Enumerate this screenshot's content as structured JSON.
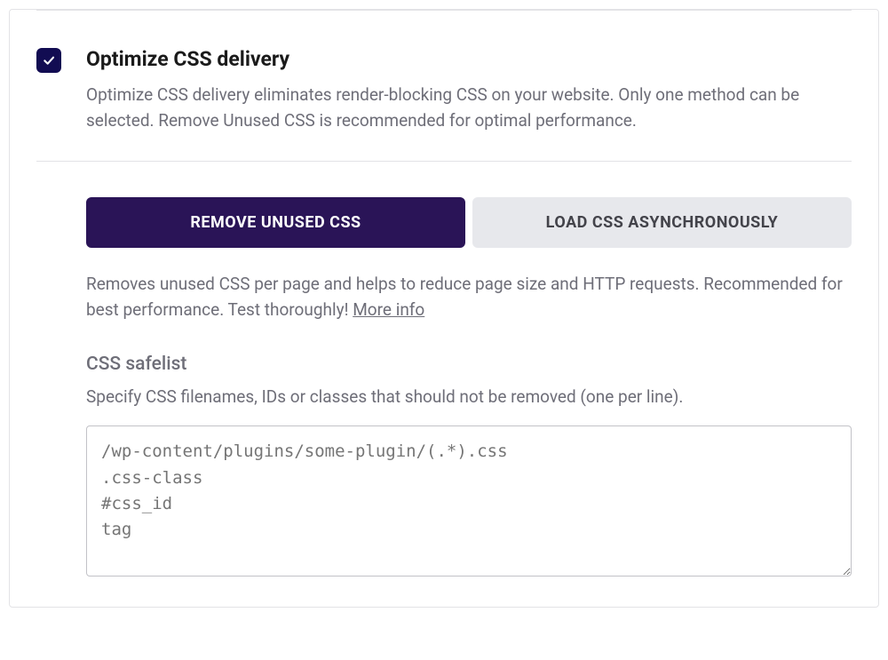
{
  "optimize": {
    "title": "Optimize CSS delivery",
    "description": "Optimize CSS delivery eliminates render-blocking CSS on your website. Only one method can be selected. Remove Unused CSS is recommended for optimal performance.",
    "tabs": {
      "remove": "REMOVE UNUSED CSS",
      "async": "LOAD CSS ASYNCHRONOUSLY"
    },
    "method_description": "Removes unused CSS per page and helps to reduce page size and HTTP requests. Recommended for best performance. Test thoroughly! ",
    "more_info": "More info",
    "safelist": {
      "title": "CSS safelist",
      "description": "Specify CSS filenames, IDs or classes that should not be removed (one per line).",
      "placeholder": "/wp-content/plugins/some-plugin/(.*).css\n.css-class\n#css_id\ntag"
    }
  }
}
